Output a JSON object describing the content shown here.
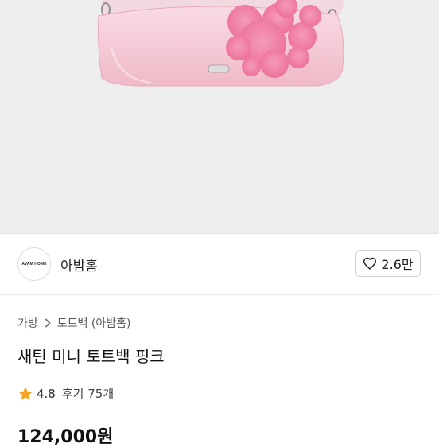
{
  "product_image": {
    "alt_icon": "pink-satin-bag-with-fluffy-bear-charm",
    "badge_icon": "brand-plate-icon"
  },
  "shop": {
    "logo_text": "AVAM HOME",
    "name": "아밤홈",
    "like_icon": "heart-outline-icon",
    "like_count": "2.6만"
  },
  "breadcrumb": {
    "items": [
      "가방",
      "토트백 (아밤홈)"
    ],
    "separator_icon": "chevron-right-icon"
  },
  "product": {
    "title": "새틴 미니 토트백 핑크",
    "rating_icon": "star-icon",
    "rating": "4.8",
    "review_text": "후기 75개",
    "price": "124,000원"
  },
  "colors": {
    "image_bg": "#eeeded",
    "bag_pink": "#f5c9d6",
    "fur_pink": "#f07fa6",
    "star": "#f5a623"
  }
}
